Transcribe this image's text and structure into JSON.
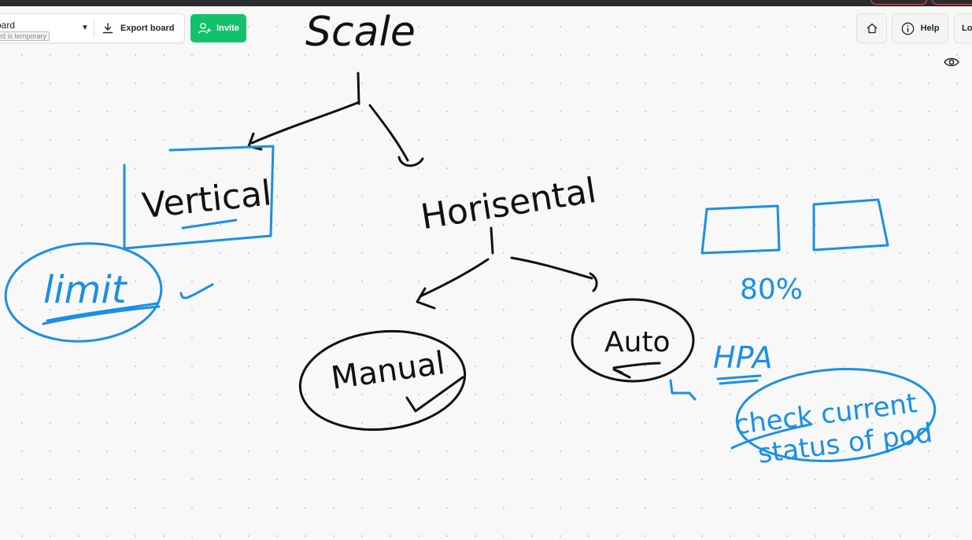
{
  "toolbar": {
    "board_title": "oard",
    "board_tag": "rd is temporary",
    "export_label": "Export board",
    "invite_label": "Invite",
    "help_label": "Help",
    "login_label": "Log"
  },
  "icons": {
    "dropdown": "caret-down-icon",
    "export": "download-icon",
    "invite": "user-plus-icon",
    "home": "home-icon",
    "help": "info-icon",
    "view": "eye-icon"
  },
  "colors": {
    "ink_black": "#111111",
    "ink_blue": "#1a8fe6",
    "invite_green": "#12c26b"
  },
  "sketch": {
    "root": "Scale",
    "vertical": "Vertical",
    "horizontal": "Horisental",
    "limit": "limit",
    "manual": "Manual",
    "auto": "Auto",
    "percent": "80%",
    "hpa": "HPA",
    "note": "check current status of pod"
  }
}
